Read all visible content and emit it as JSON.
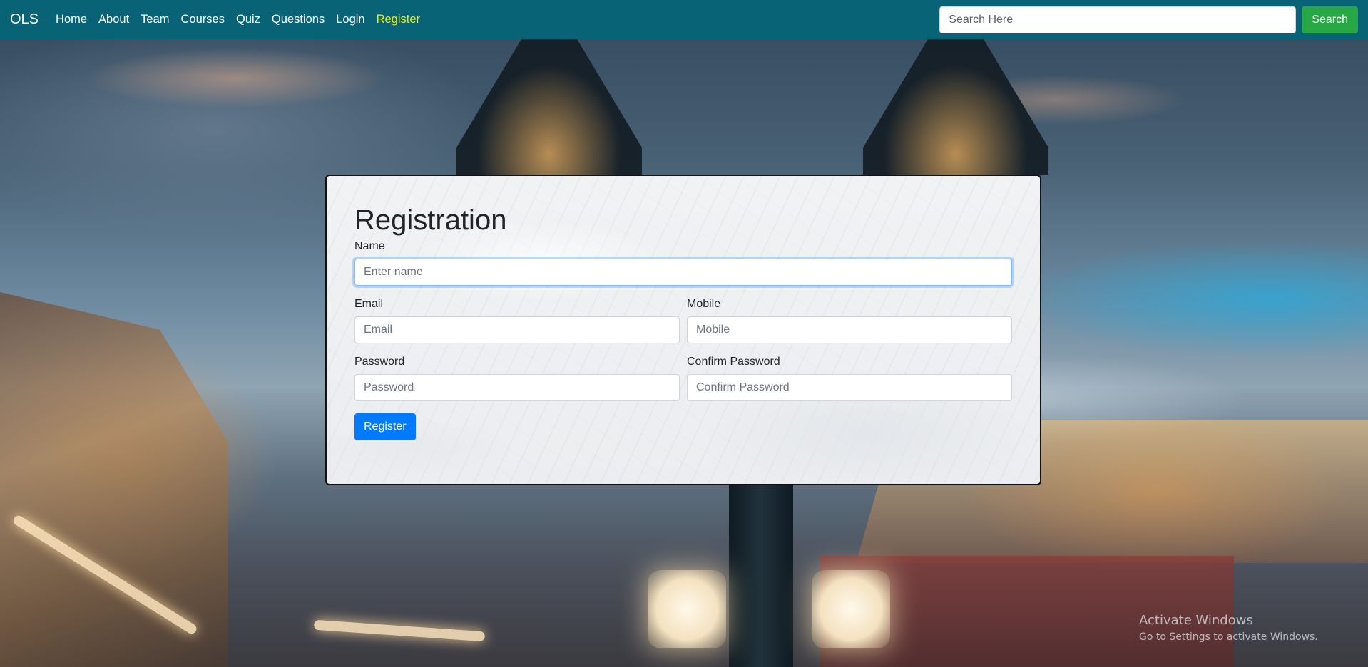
{
  "navbar": {
    "brand": "OLS",
    "links": [
      {
        "label": "Home"
      },
      {
        "label": "About"
      },
      {
        "label": "Team"
      },
      {
        "label": "Courses"
      },
      {
        "label": "Quiz"
      },
      {
        "label": "Questions"
      },
      {
        "label": "Login"
      },
      {
        "label": "Register",
        "active": true
      }
    ],
    "search": {
      "placeholder": "Search Here",
      "value": "",
      "button_label": "Search"
    },
    "background_color": "#076375",
    "active_link_color": "#f4f000"
  },
  "form": {
    "title": "Registration",
    "name": {
      "label": "Name",
      "placeholder": "Enter name",
      "value": ""
    },
    "email": {
      "label": "Email",
      "placeholder": "Email",
      "value": ""
    },
    "mobile": {
      "label": "Mobile",
      "placeholder": "Mobile",
      "value": ""
    },
    "password": {
      "label": "Password",
      "placeholder": "Password",
      "value": ""
    },
    "confirm_password": {
      "label": "Confirm Password",
      "placeholder": "Confirm Password",
      "value": ""
    },
    "submit_label": "Register",
    "submit_color": "#007bff"
  },
  "watermark": {
    "title": "Activate Windows",
    "subtitle": "Go to Settings to activate Windows."
  }
}
